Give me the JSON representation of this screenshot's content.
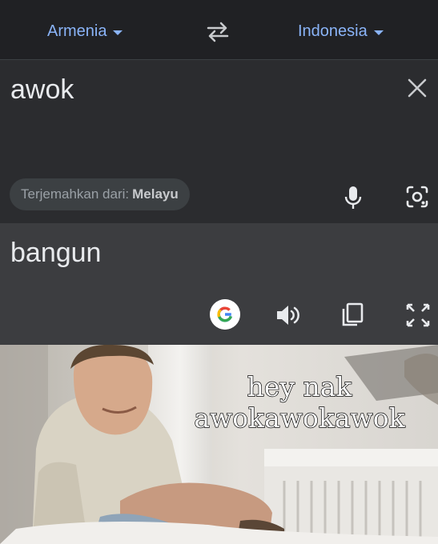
{
  "header": {
    "source_language": "Armenia",
    "target_language": "Indonesia"
  },
  "input": {
    "text": "awok",
    "detect_prefix": "Terjemahkan dari:",
    "detected_language": "Melayu"
  },
  "output": {
    "text": "bangun"
  },
  "meme": {
    "caption_line1": "hey nak",
    "caption_line2": "awokawokawok"
  },
  "colors": {
    "accent": "#8ab4f8",
    "background": "#202124",
    "input_panel": "#2b2c2f",
    "output_panel": "#3c3d40",
    "text": "#e8eaed"
  },
  "icons": [
    "caret-down-icon",
    "swap-icon",
    "close-icon",
    "mic-icon",
    "camera-lens-icon",
    "google-icon",
    "speaker-icon",
    "copy-icon",
    "fullscreen-icon"
  ]
}
